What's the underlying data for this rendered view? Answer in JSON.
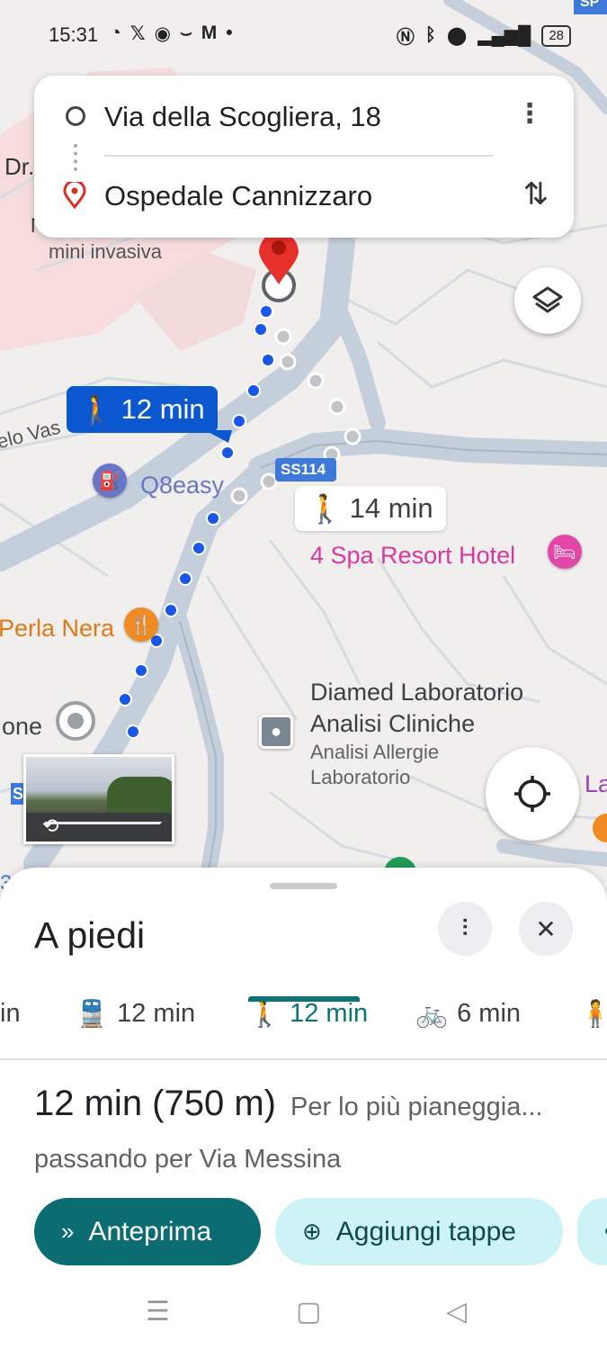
{
  "status_bar": {
    "time": "15:31",
    "left_icons": [
      "whatsapp-icon",
      "x-icon",
      "circle-app-icon",
      "amazon-icon",
      "gmail-icon",
      "dot-icon"
    ],
    "right_icons": [
      "nfc-icon",
      "bluetooth-icon",
      "location-icon",
      "signal-4g-icon"
    ],
    "battery": "28"
  },
  "route": {
    "origin": "Via della Scogliera, 18",
    "destination": "Ospedale Cannizzaro"
  },
  "map": {
    "labels": {
      "dr": "Dr.",
      "n": "N",
      "mini_invasiva": "mini invasiva",
      "angelo": "elo Vas",
      "q8": "Q8easy",
      "ss114": "SS114",
      "spa": "4 Spa Resort Hotel",
      "perla": "Perla Nera",
      "one": "one",
      "diamed_1": "Diamed Laboratorio",
      "diamed_2": "Analisi Cliniche",
      "diamed_3": "Analisi Allergie",
      "diamed_4": "Laboratorio",
      "la": "La",
      "sp": "SP",
      "s": "S",
      "three": "3"
    },
    "chips": {
      "primary_time": "12 min",
      "alt_time": "14 min"
    }
  },
  "sheet": {
    "title": "A piedi",
    "modes": [
      {
        "label": "in",
        "icon": "car-icon"
      },
      {
        "label": "12 min",
        "icon": "transit-icon"
      },
      {
        "label": "12 min",
        "icon": "walk-icon"
      },
      {
        "label": "6 min",
        "icon": "bike-icon"
      },
      {
        "label": "",
        "icon": "ride-icon"
      }
    ],
    "summary": "12 min (750 m)",
    "summary_note": "Per lo più pianeggia...",
    "via": "passando per Via Messina",
    "preview_button": "Anteprima",
    "add_stops_button": "Aggiungi tappe"
  }
}
